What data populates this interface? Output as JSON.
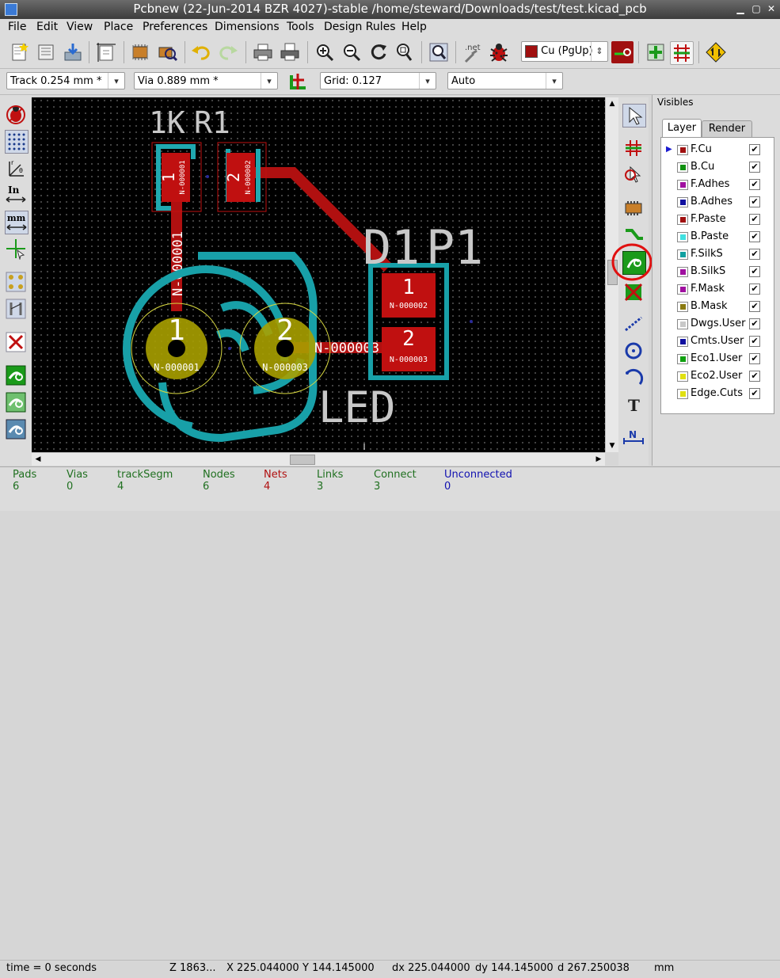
{
  "window": {
    "title": "Pcbnew (22-Jun-2014 BZR 4027)-stable /home/steward/Downloads/test/test.kicad_pcb"
  },
  "menu": [
    "File",
    "Edit",
    "View",
    "Place",
    "Preferences",
    "Dimensions",
    "Tools",
    "Design Rules",
    "Help"
  ],
  "toolbar": {
    "layer_select": "Cu (PgUp)",
    "net_label": ".net"
  },
  "aux_toolbar": {
    "track": "Track 0.254 mm *",
    "via": "Via 0.889 mm *",
    "grid": "Grid: 0.127",
    "zoom": "Auto"
  },
  "left_toolbar": {
    "inch_label": "In",
    "mm_label": "mm"
  },
  "right_toolbar": {
    "text_tool": "T",
    "navigator_label": "N"
  },
  "board": {
    "r1_ref": "R1",
    "r1_value": "1K",
    "r1_pad1": {
      "num": "1",
      "net": "N-000001"
    },
    "r1_pad2": {
      "num": "2",
      "net": "N-000002"
    },
    "p1_ref": "P1",
    "p1_value": "D1",
    "p1_pad1": {
      "num": "1",
      "net": "N-000002"
    },
    "p1_pad2": {
      "num": "2",
      "net": "N-000003"
    },
    "led_value": "LED",
    "led_pad1": {
      "num": "1",
      "net": "N-000001"
    },
    "led_pad2": {
      "num": "2",
      "net": "N-000003"
    },
    "track_label_1": "N-000001",
    "track_label_3": "N-000003"
  },
  "visibles": {
    "title": "Visibles",
    "tabs": [
      "Layer",
      "Render"
    ],
    "layers": [
      {
        "name": "F.Cu",
        "color": "#a01010",
        "checked": true,
        "active": true
      },
      {
        "name": "B.Cu",
        "color": "#109010",
        "checked": true
      },
      {
        "name": "F.Adhes",
        "color": "#a010a0",
        "checked": true
      },
      {
        "name": "B.Adhes",
        "color": "#1010a0",
        "checked": true
      },
      {
        "name": "F.Paste",
        "color": "#a01010",
        "checked": true
      },
      {
        "name": "B.Paste",
        "color": "#40e0e0",
        "checked": true
      },
      {
        "name": "F.SilkS",
        "color": "#10a0a0",
        "checked": true
      },
      {
        "name": "B.SilkS",
        "color": "#a010a0",
        "checked": true
      },
      {
        "name": "F.Mask",
        "color": "#a010a0",
        "checked": true
      },
      {
        "name": "B.Mask",
        "color": "#8a7a10",
        "checked": true
      },
      {
        "name": "Dwgs.User",
        "color": "#c8c8c8",
        "checked": true
      },
      {
        "name": "Cmts.User",
        "color": "#1010a0",
        "checked": true
      },
      {
        "name": "Eco1.User",
        "color": "#10a010",
        "checked": true
      },
      {
        "name": "Eco2.User",
        "color": "#e0e010",
        "checked": true
      },
      {
        "name": "Edge.Cuts",
        "color": "#e0e010",
        "checked": true
      }
    ]
  },
  "stats": [
    {
      "label": "Pads",
      "value": "6",
      "color": "#207020"
    },
    {
      "label": "Vias",
      "value": "0",
      "color": "#207020"
    },
    {
      "label": "trackSegm",
      "value": "4",
      "color": "#207020"
    },
    {
      "label": "Nodes",
      "value": "6",
      "color": "#207020"
    },
    {
      "label": "Nets",
      "value": "4",
      "color": "#b01010"
    },
    {
      "label": "Links",
      "value": "3",
      "color": "#207020"
    },
    {
      "label": "Connect",
      "value": "3",
      "color": "#207020"
    },
    {
      "label": "Unconnected",
      "value": "0",
      "color": "#1010b0"
    }
  ],
  "statusbar": {
    "time": "time = 0 seconds",
    "zoom": "Z 1863...",
    "x": "X 225.044000",
    "y": "Y 144.145000",
    "dx": "dx 225.044000",
    "dy": "dy 144.145000",
    "d": "d 267.250038",
    "units": "mm"
  }
}
